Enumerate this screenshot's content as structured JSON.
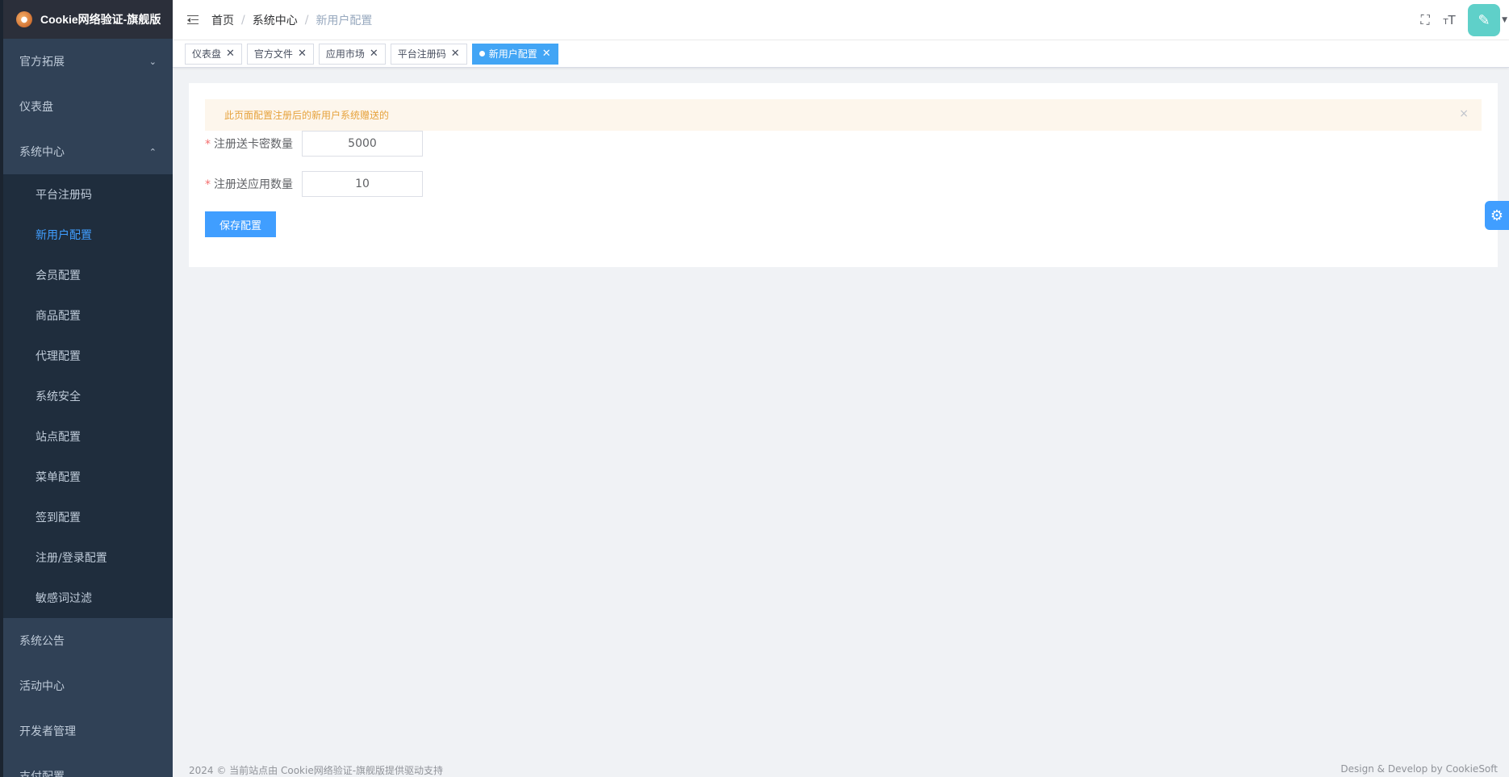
{
  "app": {
    "title": "Cookie网络验证-旗舰版"
  },
  "sidebar": {
    "top_items": [
      {
        "label": "官方拓展",
        "chevron": "down"
      },
      {
        "label": "仪表盘"
      },
      {
        "label": "系统中心",
        "chevron": "up"
      }
    ],
    "sub_items": [
      {
        "label": "平台注册码"
      },
      {
        "label": "新用户配置",
        "active": true
      },
      {
        "label": "会员配置"
      },
      {
        "label": "商品配置"
      },
      {
        "label": "代理配置"
      },
      {
        "label": "系统安全"
      },
      {
        "label": "站点配置"
      },
      {
        "label": "菜单配置"
      },
      {
        "label": "签到配置"
      },
      {
        "label": "注册/登录配置"
      },
      {
        "label": "敏感词过滤"
      }
    ],
    "bottom_items": [
      {
        "label": "系统公告"
      },
      {
        "label": "活动中心"
      },
      {
        "label": "开发者管理"
      },
      {
        "label": "支付配置",
        "chevron": "down"
      }
    ]
  },
  "breadcrumb": {
    "home": "首页",
    "section": "系统中心",
    "current": "新用户配置"
  },
  "tags": [
    {
      "label": "仪表盘"
    },
    {
      "label": "官方文件"
    },
    {
      "label": "应用市场"
    },
    {
      "label": "平台注册码"
    },
    {
      "label": "新用户配置",
      "active": true
    }
  ],
  "alert": {
    "text": "此页面配置注册后的新用户系统赠送的",
    "close": "×"
  },
  "form": {
    "card_count_label": "注册送卡密数量",
    "card_count_value": "5000",
    "app_count_label": "注册送应用数量",
    "app_count_value": "10",
    "required_mark": "*",
    "save_label": "保存配置"
  },
  "footer": {
    "left": "2024 © 当前站点由 Cookie网络验证-旗舰版提供驱动支持",
    "right": "Design & Develop by CookieSoft"
  },
  "colors": {
    "accent": "#409eff",
    "sidebar_bg": "#304156",
    "submenu_bg": "#1f2d3d",
    "alert_bg": "#fdf6ec",
    "alert_text": "#e6a23c"
  },
  "icons": {
    "fullscreen": "fullscreen-icon",
    "font_size": "font-size-icon",
    "settings": "gear-icon",
    "hamburger": "hamburger-icon"
  }
}
